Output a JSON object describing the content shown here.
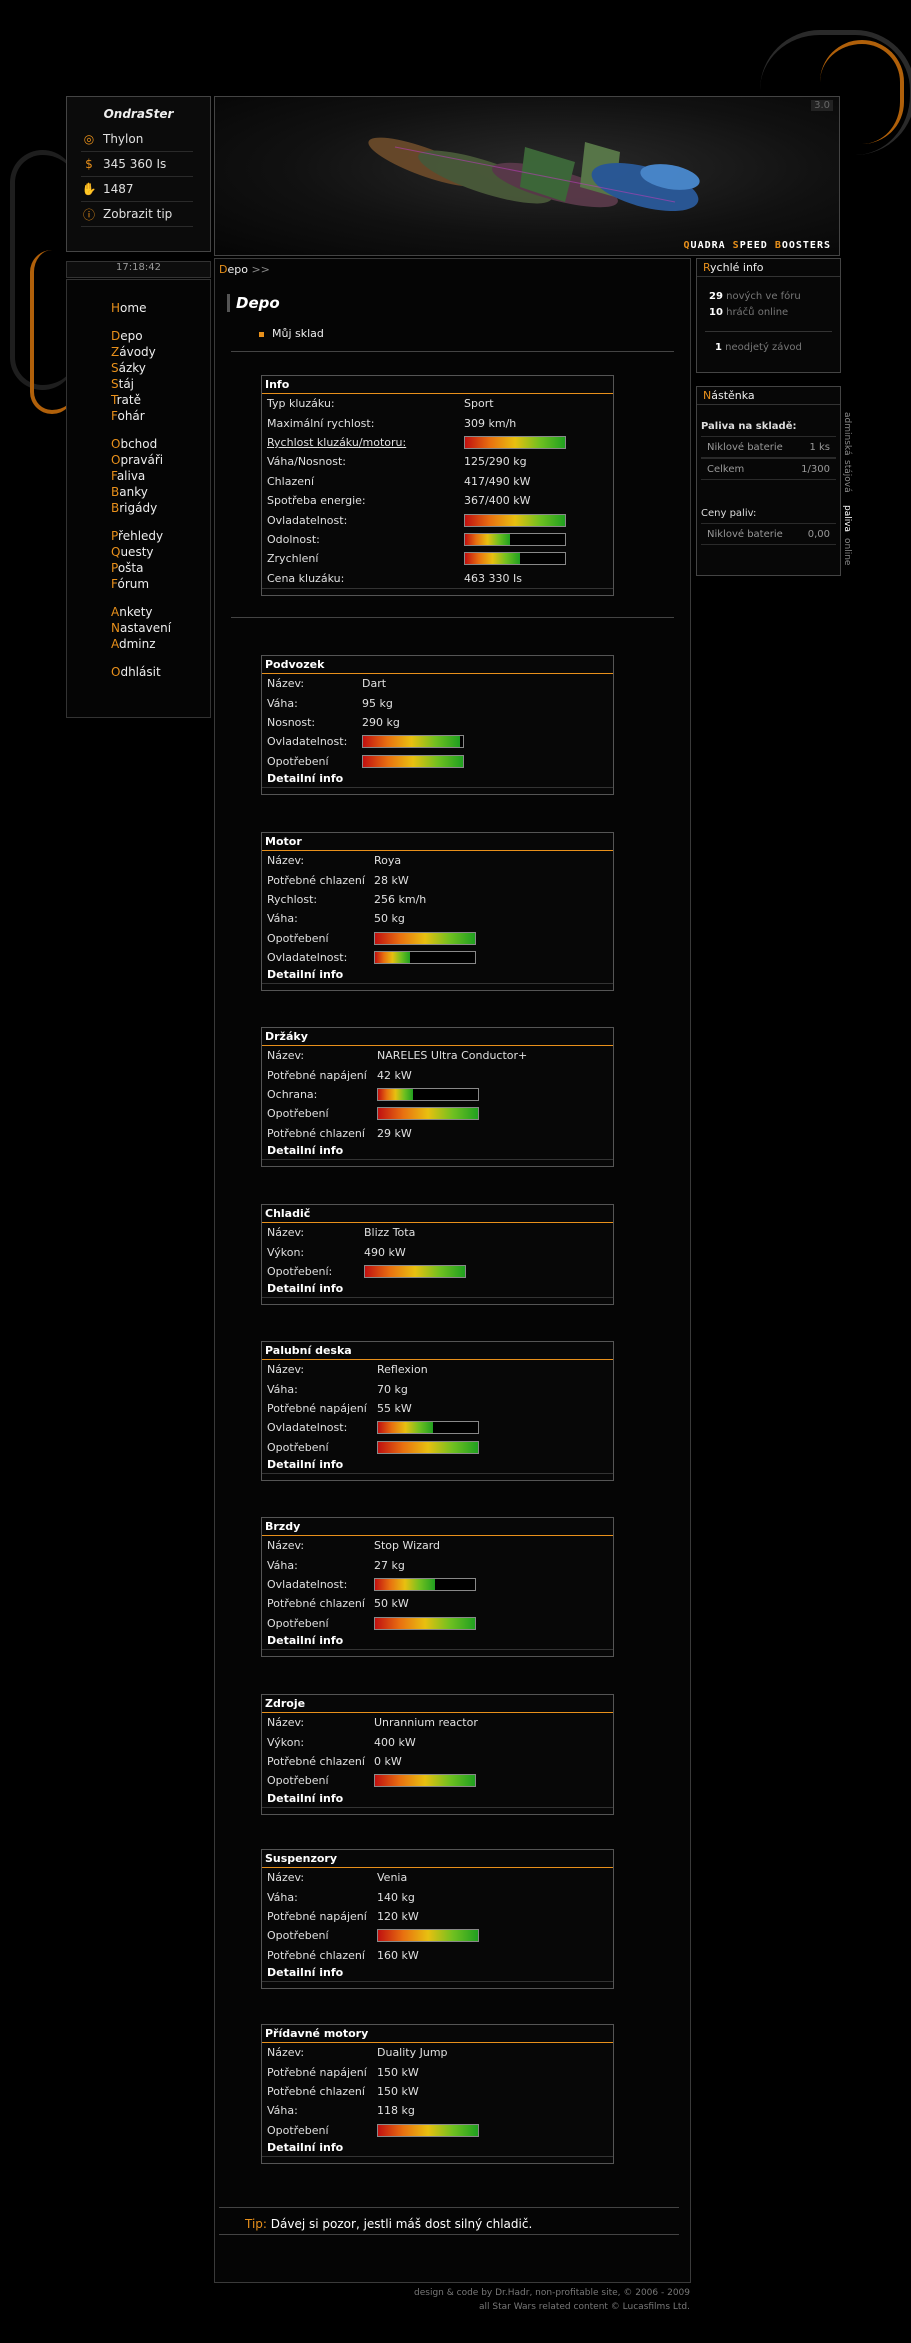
{
  "user": {
    "name": "OndraSter",
    "rows": [
      {
        "icon": "planet-icon",
        "glyph": "◎",
        "text": "Thylon"
      },
      {
        "icon": "dollar-icon",
        "glyph": "$",
        "text": "345 360 Is"
      },
      {
        "icon": "hand-icon",
        "glyph": "✋",
        "text": "1487"
      },
      {
        "icon": "tip-icon",
        "glyph": "ⓘ",
        "text": "Zobrazit tip"
      }
    ]
  },
  "banner": {
    "version": "3.0",
    "brand_parts": [
      {
        "cap": "Q",
        "rest": "UADRA "
      },
      {
        "cap": "S",
        "rest": "PEED "
      },
      {
        "cap": "B",
        "rest": "OOSTERS"
      }
    ]
  },
  "clock": "17:18:42",
  "nav": [
    [
      {
        "cap": "H",
        "rest": "ome"
      }
    ],
    [
      {
        "cap": "D",
        "rest": "epo"
      },
      {
        "cap": "Z",
        "rest": "ávody"
      },
      {
        "cap": "S",
        "rest": "ázky"
      },
      {
        "cap": "S",
        "rest": "táj"
      },
      {
        "cap": "T",
        "rest": "ratě"
      },
      {
        "cap": "F",
        "rest": "ohár"
      }
    ],
    [
      {
        "cap": "O",
        "rest": "bchod"
      },
      {
        "cap": "O",
        "rest": "praváři"
      },
      {
        "cap": "F",
        "rest": "aliva"
      },
      {
        "cap": "B",
        "rest": "anky"
      },
      {
        "cap": "B",
        "rest": "rigády"
      }
    ],
    [
      {
        "cap": "P",
        "rest": "řehledy"
      },
      {
        "cap": "Q",
        "rest": "uesty"
      },
      {
        "cap": "P",
        "rest": "ošta"
      },
      {
        "cap": "F",
        "rest": "órum"
      }
    ],
    [
      {
        "cap": "A",
        "rest": "nkety"
      },
      {
        "cap": "N",
        "rest": "astavení"
      },
      {
        "cap": "A",
        "rest": "dminz"
      }
    ],
    [
      {
        "cap": "O",
        "rest": "dhlásit"
      }
    ]
  ],
  "breadcrumb": {
    "cap": "D",
    "rest": "epo",
    "arrow": ">>"
  },
  "page_title": "Depo",
  "store_link": "Můj sklad",
  "info": {
    "title": "Info",
    "rows": [
      {
        "label": "Typ kluzáku:",
        "value": "Sport"
      },
      {
        "label": "Maximální rychlost:",
        "value": "309 km/h"
      },
      {
        "label": "Rychlost kluzáku/motoru:",
        "bar": 1.0,
        "underline": true
      },
      {
        "label": "Váha/Nosnost:",
        "value": "125/290 kg"
      },
      {
        "label": "Chlazení",
        "value": "417/490 kW"
      },
      {
        "label": "Spotřeba energie:",
        "value": "367/400 kW"
      },
      {
        "label": "Ovladatelnost:",
        "bar": 1.0
      },
      {
        "label": "Odolnost:",
        "bar": 0.45
      },
      {
        "label": "Zrychlení",
        "bar": 0.55
      },
      {
        "label": "Cena kluzáku:",
        "value": "463 330 Is"
      }
    ]
  },
  "detail_label": "Detailní info",
  "parts": [
    {
      "title": "Podvozek",
      "rows": [
        {
          "label": "Název:",
          "value": "Dart"
        },
        {
          "label": "Váha:",
          "value": "95 kg"
        },
        {
          "label": "Nosnost:",
          "value": "290 kg"
        },
        {
          "label": "Ovladatelnost:",
          "bar": 0.97
        },
        {
          "label": "Opotřebení",
          "bar": 1.0
        }
      ]
    },
    {
      "title": "Motor",
      "rows": [
        {
          "label": "Název:",
          "value": "Roya"
        },
        {
          "label": "Potřebné chlazení",
          "value": "28 kW"
        },
        {
          "label": "Rychlost:",
          "value": "256 km/h"
        },
        {
          "label": "Váha:",
          "value": "50 kg"
        },
        {
          "label": "Opotřebení",
          "bar": 1.0
        },
        {
          "label": "Ovladatelnost:",
          "bar": 0.35
        }
      ]
    },
    {
      "title": "Držáky",
      "rows": [
        {
          "label": "Název:",
          "value": "NARELES Ultra Conductor+"
        },
        {
          "label": "Potřebné napájení",
          "value": "42 kW"
        },
        {
          "label": "Ochrana:",
          "bar": 0.35
        },
        {
          "label": "Opotřebení",
          "bar": 1.0
        },
        {
          "label": "Potřebné chlazení",
          "value": "29 kW"
        }
      ]
    },
    {
      "title": "Chladič",
      "rows": [
        {
          "label": "Název:",
          "value": "Blizz Tota"
        },
        {
          "label": "Výkon:",
          "value": "490 kW"
        },
        {
          "label": "Opotřebení:",
          "bar": 1.0
        }
      ]
    },
    {
      "title": "Palubní deska",
      "rows": [
        {
          "label": "Název:",
          "value": "Reflexion"
        },
        {
          "label": "Váha:",
          "value": "70 kg"
        },
        {
          "label": "Potřebné napájení",
          "value": "55 kW"
        },
        {
          "label": "Ovladatelnost:",
          "bar": 0.55
        },
        {
          "label": "Opotřebení",
          "bar": 1.0
        }
      ]
    },
    {
      "title": "Brzdy",
      "rows": [
        {
          "label": "Název:",
          "value": "Stop Wizard"
        },
        {
          "label": "Váha:",
          "value": "27 kg"
        },
        {
          "label": "Ovladatelnost:",
          "bar": 0.6
        },
        {
          "label": "Potřebné chlazení",
          "value": "50 kW"
        },
        {
          "label": "Opotřebení",
          "bar": 1.0
        }
      ]
    },
    {
      "title": "Zdroje",
      "rows": [
        {
          "label": "Název:",
          "value": "Unrannium reactor"
        },
        {
          "label": "Výkon:",
          "value": "400 kW"
        },
        {
          "label": "Potřebné chlazení",
          "value": "0 kW"
        },
        {
          "label": "Opotřebení",
          "bar": 1.0
        }
      ]
    },
    {
      "title": "Suspenzory",
      "rows": [
        {
          "label": "Název:",
          "value": "Venia"
        },
        {
          "label": "Váha:",
          "value": "140 kg"
        },
        {
          "label": "Potřebné napájení",
          "value": "120 kW"
        },
        {
          "label": "Opotřebení",
          "bar": 1.0
        },
        {
          "label": "Potřebné chlazení",
          "value": "160 kW"
        }
      ]
    },
    {
      "title": "Přídavné motory",
      "rows": [
        {
          "label": "Název:",
          "value": "Duality Jump"
        },
        {
          "label": "Potřebné napájení",
          "value": "150 kW"
        },
        {
          "label": "Potřebné chlazení",
          "value": "150 kW"
        },
        {
          "label": "Váha:",
          "value": "118 kg"
        },
        {
          "label": "Opotřebení",
          "bar": 1.0
        }
      ]
    }
  ],
  "quick": {
    "title_cap": "R",
    "title_rest": "ychlé info",
    "lines": [
      {
        "num": "29",
        "text": "nových ve fóru"
      },
      {
        "num": "10",
        "text": "hráčů online"
      },
      {
        "num": "1",
        "text": "neodjetý závod"
      }
    ]
  },
  "board": {
    "title_cap": "N",
    "title_rest": "ástěnka",
    "fuel_title": "Paliva na skladě:",
    "fuel": [
      {
        "name": "Niklové baterie",
        "value": "1 ks"
      },
      {
        "name": "Celkem",
        "value": "1/300"
      }
    ],
    "price_title": "Ceny paliv:",
    "prices": [
      {
        "name": "Niklové baterie",
        "value": "0,00"
      }
    ],
    "tabs": [
      "adminská",
      "stájová",
      "paliva",
      "online"
    ]
  },
  "tip": {
    "label": "Tip:",
    "text": "Dávej si pozor, jestli máš dost silný chladič."
  },
  "credits": [
    "design & code by Dr.Hadr, non-profitable site, © 2006 - 2009",
    "all Star Wars related content © Lucasfilms Ltd."
  ]
}
